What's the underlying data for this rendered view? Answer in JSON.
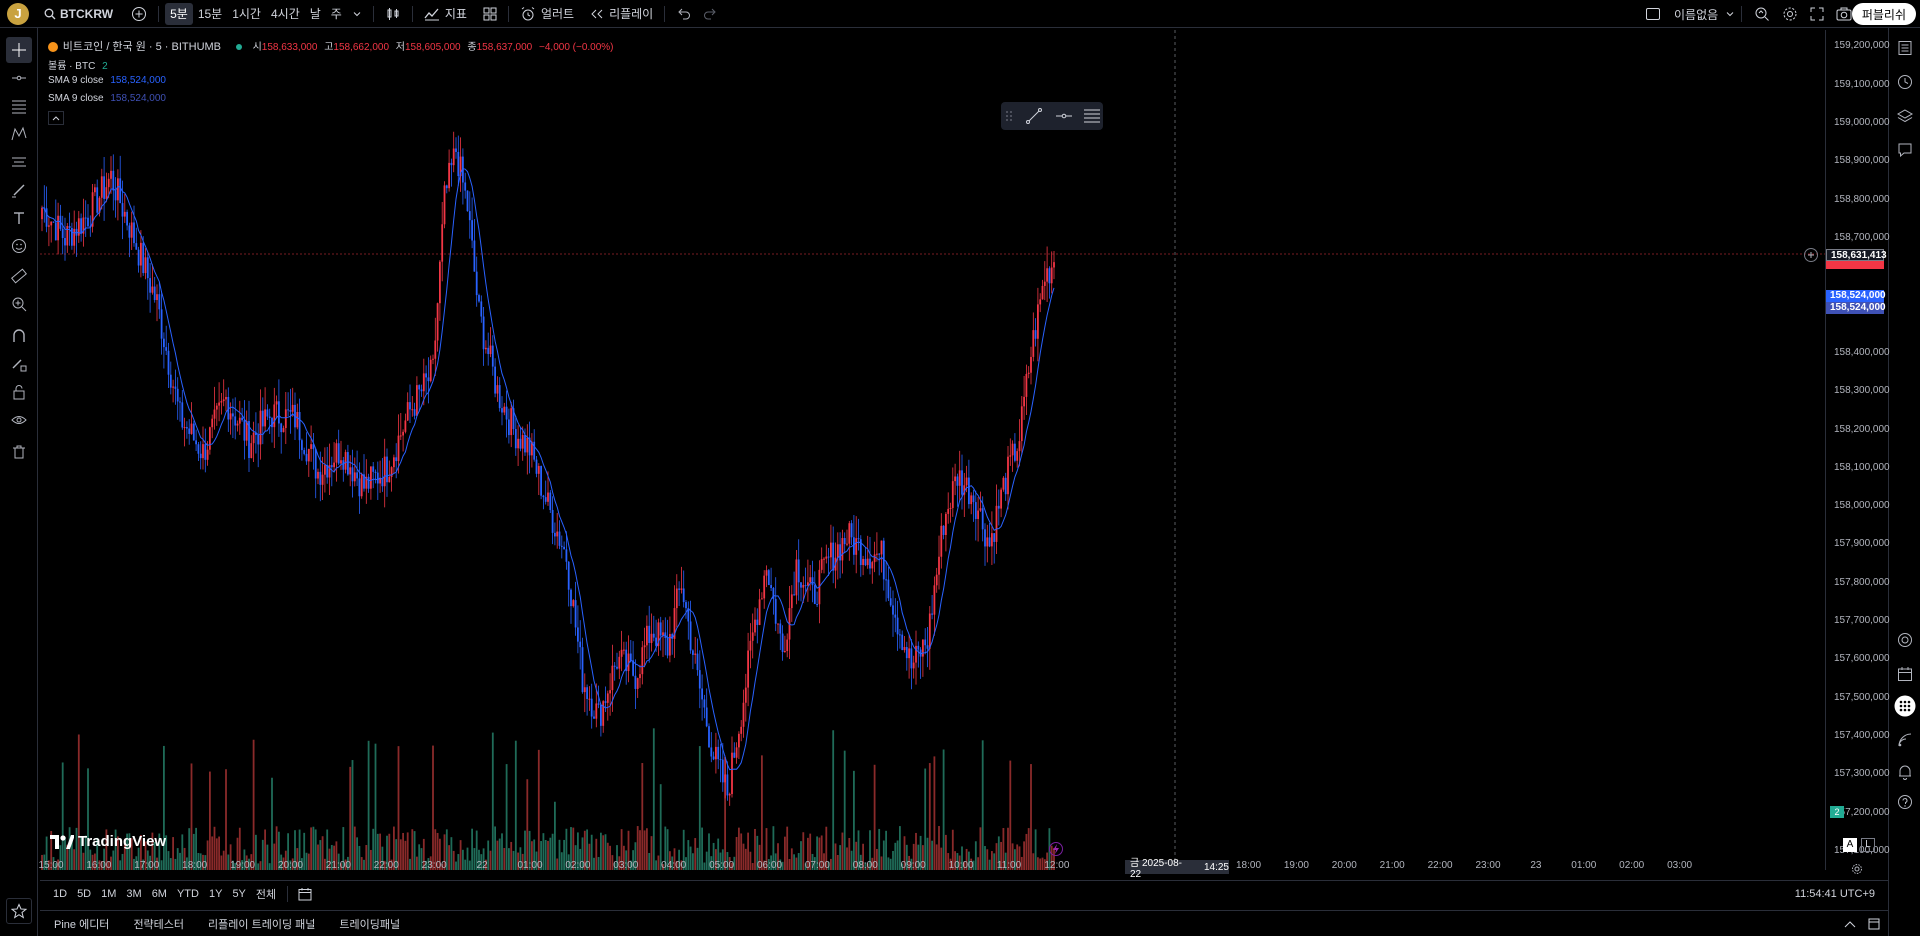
{
  "colors": {
    "up": "#f23645",
    "down": "#2962ff",
    "sma": "#2962ff",
    "vol_up": "#8a2a2a",
    "vol_down": "#1f6b58",
    "bg": "#000000"
  },
  "topbar": {
    "avatar_letter": "J",
    "symbol": "BTCKRW",
    "intervals": [
      "5분",
      "15분",
      "1시간",
      "4시간",
      "날",
      "주"
    ],
    "active_interval": "5분",
    "indicators_label": "지표",
    "alert_label": "얼러트",
    "replay_label": "리플레이",
    "layout_name": "이름없음",
    "publish_label": "퍼블리쉬"
  },
  "legend": {
    "title": "비트코인 / 한국 원 · 5 · BITHUMB",
    "o_label": "시",
    "o": "158,633,000",
    "h_label": "고",
    "h": "158,662,000",
    "l_label": "저",
    "l": "158,605,000",
    "c_label": "종",
    "c": "158,637,000",
    "change": "−4,000 (−0.00%)",
    "volume": "볼륨 · BTC",
    "volume_value": "2",
    "sma1_label": "SMA 9 close",
    "sma1_value": "158,524,000",
    "sma2_label": "SMA 9 close",
    "sma2_value": "158,524,000"
  },
  "price_scale": {
    "ticks": [
      "159,200,000",
      "159,100,000",
      "159,000,000",
      "158,900,000",
      "158,800,000",
      "158,700,000",
      "158,400,000",
      "158,300,000",
      "158,200,000",
      "158,100,000",
      "158,000,000",
      "157,900,000",
      "157,800,000",
      "157,700,000",
      "157,600,000",
      "157,500,000",
      "157,400,000",
      "157,300,000",
      "157,200,000",
      "157,100,000"
    ],
    "crosshair_label": "158,631,413",
    "sma_label_1": "158,524,000",
    "sma_label_2": "158,524,000",
    "volume_badge": "2"
  },
  "time_scale": {
    "ticks": [
      "15:00",
      "16:00",
      "17:00",
      "18:00",
      "19:00",
      "20:00",
      "21:00",
      "22:00",
      "23:00",
      "22",
      "01:00",
      "02:00",
      "03:00",
      "04:00",
      "05:00",
      "06:00",
      "07:00",
      "08:00",
      "09:00",
      "10:00",
      "11:00",
      "12:00",
      "13:00",
      "16:00",
      "17:00",
      "18:00",
      "19:00",
      "20:00",
      "21:00",
      "22:00",
      "23:00",
      "23",
      "01:00",
      "02:00",
      "03:00"
    ],
    "crosshair_date": "금 2025-08-22",
    "crosshair_time": "14:25"
  },
  "range_bar": {
    "ranges": [
      "1D",
      "5D",
      "1M",
      "3M",
      "6M",
      "YTD",
      "1Y",
      "5Y",
      "전체"
    ],
    "clock": "11:54:41 UTC+9"
  },
  "bottom_tabs": [
    "Pine 에디터",
    "전략테스터",
    "리플레이 트레이딩 패널",
    "트레이딩패널"
  ],
  "watermark": "TradingView",
  "scale_buttons": {
    "auto": "A",
    "log": "L"
  },
  "chart_data": {
    "type": "candlestick",
    "symbol": "BTCKRW",
    "interval": "5",
    "exchange": "BITHUMB",
    "ylim": [
      157050000,
      159230000
    ],
    "last": {
      "open": 158633000,
      "high": 158662000,
      "low": 158605000,
      "close": 158637000
    },
    "sma9_last": 158524000,
    "crosshair_price": 158631413,
    "anchors": [
      [
        0,
        158780000
      ],
      [
        10,
        158700000
      ],
      [
        20,
        158760000
      ],
      [
        30,
        158860000
      ],
      [
        40,
        158700000
      ],
      [
        50,
        158530000
      ],
      [
        60,
        158230000
      ],
      [
        70,
        158140000
      ],
      [
        80,
        158280000
      ],
      [
        90,
        158170000
      ],
      [
        100,
        158240000
      ],
      [
        110,
        158230000
      ],
      [
        120,
        158090000
      ],
      [
        130,
        158150000
      ],
      [
        140,
        158050000
      ],
      [
        150,
        158100000
      ],
      [
        160,
        158250000
      ],
      [
        170,
        158350000
      ],
      [
        175,
        158800000
      ],
      [
        180,
        158930000
      ],
      [
        185,
        158780000
      ],
      [
        190,
        158500000
      ],
      [
        198,
        158300000
      ],
      [
        205,
        158200000
      ],
      [
        212,
        158150000
      ],
      [
        220,
        158000000
      ],
      [
        228,
        157870000
      ],
      [
        235,
        157550000
      ],
      [
        242,
        157450000
      ],
      [
        250,
        157600000
      ],
      [
        258,
        157560000
      ],
      [
        265,
        157680000
      ],
      [
        272,
        157630000
      ],
      [
        278,
        157800000
      ],
      [
        285,
        157550000
      ],
      [
        292,
        157350000
      ],
      [
        298,
        157250000
      ],
      [
        305,
        157500000
      ],
      [
        310,
        157700000
      ],
      [
        315,
        157850000
      ],
      [
        322,
        157620000
      ],
      [
        328,
        157850000
      ],
      [
        335,
        157760000
      ],
      [
        342,
        157860000
      ],
      [
        350,
        157920000
      ],
      [
        358,
        157880000
      ],
      [
        365,
        157870000
      ],
      [
        372,
        157700000
      ],
      [
        378,
        157580000
      ],
      [
        385,
        157650000
      ],
      [
        392,
        157960000
      ],
      [
        398,
        158080000
      ],
      [
        405,
        158030000
      ],
      [
        412,
        157900000
      ],
      [
        418,
        158050000
      ],
      [
        425,
        158180000
      ],
      [
        430,
        158400000
      ],
      [
        436,
        158600000
      ],
      [
        440,
        158637000
      ]
    ],
    "x_labels": [
      "15:00",
      "16:00",
      "17:00",
      "18:00",
      "19:00",
      "20:00",
      "21:00",
      "22:00",
      "23:00",
      "22",
      "01:00",
      "02:00",
      "03:00",
      "04:00",
      "05:00",
      "06:00",
      "07:00",
      "08:00",
      "09:00",
      "10:00",
      "11:00",
      "12:00"
    ]
  }
}
